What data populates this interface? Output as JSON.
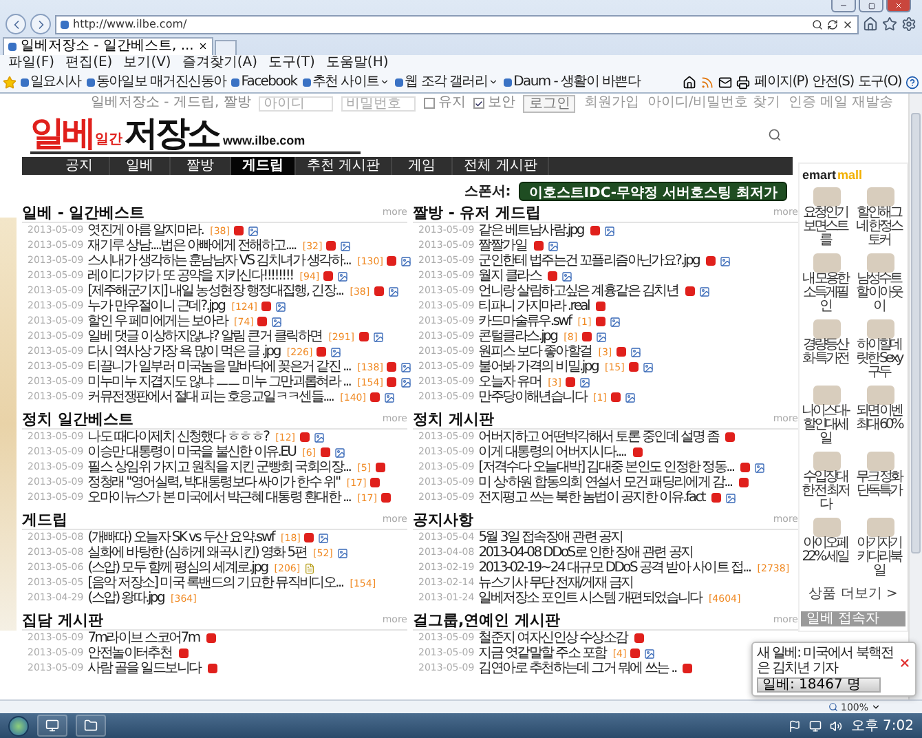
{
  "browser": {
    "url": "http://www.ilbe.com/",
    "tab_title": "일베저장소 - 일간베스트, ...",
    "menu": [
      "파일(F)",
      "편집(E)",
      "보기(V)",
      "즐겨찾기(A)",
      "도구(T)",
      "도움말(H)"
    ],
    "favorites": [
      {
        "label": "일요시사",
        "has_caret": false
      },
      {
        "label": "동아일보 매거진신동아",
        "has_caret": false
      },
      {
        "label": "Facebook",
        "has_caret": false
      },
      {
        "label": "추천 사이트",
        "has_caret": true
      },
      {
        "label": "웹 조각 갤러리",
        "has_caret": true
      },
      {
        "label": "Daum - 생활이 바쁜다",
        "has_caret": false
      }
    ],
    "commands": [
      "페이지(P)",
      "안전(S)",
      "도구(O)"
    ]
  },
  "login": {
    "site": "일베저장소 - 게드립, 짤방",
    "id_placeholder": "아이디",
    "pw_placeholder": "비밀번호",
    "options": [
      {
        "label": "유지",
        "checked": false
      },
      {
        "label": "보안",
        "checked": true
      }
    ],
    "button": "로그인",
    "links": [
      "회원가입",
      "아이디/비밀번호 찾기",
      "인증 메일 재발송"
    ]
  },
  "logo": {
    "main_a": "일베",
    "small": "일간",
    "main_b": "저장소",
    "url": "www.ilbe.com"
  },
  "nav": [
    {
      "label": "공지",
      "selected": false
    },
    {
      "label": "일베",
      "selected": false
    },
    {
      "label": "짤방",
      "selected": false
    },
    {
      "label": "게드립",
      "selected": true
    },
    {
      "label": "추천 게시판",
      "selected": false
    },
    {
      "label": "게임",
      "selected": false
    },
    {
      "label": "전체 게시판",
      "selected": false
    }
  ],
  "sponsor": {
    "label": "스폰서:",
    "button": "이호스트IDC-무약정 서버호스팅 최저가"
  },
  "sections": [
    {
      "title": "일베 - 일간베스트",
      "more": "more",
      "items": [
        {
          "date": "2013-05-09",
          "title": "엿진게 아름 알지마라.",
          "count": "[38]",
          "hot": true,
          "photo": true
        },
        {
          "date": "2013-05-09",
          "title": "재기루 상남....법은 아빠에게 전해하고....",
          "count": "[32]",
          "hot": true,
          "photo": true
        },
        {
          "date": "2013-05-09",
          "title": "스시내가 생각하는 훈남남자 VS 김치녀가 생각하...",
          "count": "[130]",
          "hot": true,
          "photo": true
        },
        {
          "date": "2013-05-09",
          "title": "레이디가가가 또 공약을 지키신다!!!!!!!!",
          "count": "[94]",
          "hot": true,
          "photo": true
        },
        {
          "date": "2013-05-09",
          "title": "[제주해군기지] 내일 농성현장 행정대집행, 긴장...",
          "count": "[38]",
          "hot": true,
          "photo": true
        },
        {
          "date": "2013-05-09",
          "title": "누가 만우절이니 근데?.jpg",
          "count": "[124]",
          "hot": true,
          "photo": true
        },
        {
          "date": "2013-05-09",
          "title": "할인 우 페미에게는 보아라",
          "count": "[74]",
          "hot": true,
          "photo": true
        },
        {
          "date": "2013-05-09",
          "title": "일베 댓글 이상하지않냐? 알림 큰거 클릭하면",
          "count": "[291]",
          "hot": true,
          "photo": true
        },
        {
          "date": "2013-05-09",
          "title": "다시 역사상 가장 욕 많이 먹은 글 .jpg",
          "count": "[226]",
          "hot": true,
          "photo": true
        },
        {
          "date": "2013-05-09",
          "title": "티끌니가 일부러 미국놈을 말바닥에 꽂은거 같진 ...",
          "count": "[138]",
          "hot": true,
          "photo": true
        },
        {
          "date": "2013-05-09",
          "title": "미누미누 지겹지도 않냐 ㅡㅡ 미누 그만괴롭혀라 ...",
          "count": "[154]",
          "hot": true,
          "photo": true
        },
        {
          "date": "2013-05-09",
          "title": "커뮤전쟁판에서 절대 피는 호응교일ㅋㅋ센들....",
          "count": "[140]",
          "hot": true,
          "photo": true
        }
      ]
    },
    {
      "title": "짤방 - 유저 게드립",
      "more": "more",
      "items": [
        {
          "date": "2013-05-09",
          "title": "같은 베트남사람.jpg",
          "hot": true,
          "photo": true
        },
        {
          "date": "2013-05-09",
          "title": "짤짤가일",
          "hot": true,
          "photo": true
        },
        {
          "date": "2013-05-09",
          "title": "군인한테 법주는건 꼬플리즘아닌가요?.jpg",
          "hot": true,
          "photo": true
        },
        {
          "date": "2013-05-09",
          "title": "월지 클라스",
          "hot": true,
          "photo": true
        },
        {
          "date": "2013-05-09",
          "title": "언니랑 살림하고싶은 계흉같은 김치년",
          "hot": true,
          "photo": true
        },
        {
          "date": "2013-05-09",
          "title": "티파니 가지마라 .real",
          "hot": true,
          "photo": false
        },
        {
          "date": "2013-05-09",
          "title": "카드마술류우.swf",
          "count": "[1]",
          "hot": true,
          "photo": true
        },
        {
          "date": "2013-05-09",
          "title": "콘털클라스.jpg",
          "count": "[8]",
          "hot": true,
          "photo": true
        },
        {
          "date": "2013-05-09",
          "title": "원피스 보다 좋아할걸",
          "count": "[3]",
          "hot": true,
          "photo": true
        },
        {
          "date": "2013-05-09",
          "title": "불어봐 가격의 비밀.jpg",
          "count": "[15]",
          "hot": true,
          "photo": true
        },
        {
          "date": "2013-05-09",
          "title": "오늘자 유머",
          "count": "[3]",
          "hot": true,
          "photo": true
        },
        {
          "date": "2013-05-09",
          "title": "만주당이해년습니다",
          "count": "[1]",
          "hot": true,
          "photo": true
        }
      ]
    },
    {
      "title": "정치 일간베스트",
      "more": "more",
      "items": [
        {
          "date": "2013-05-09",
          "title": "나도 때다이제치 신청했다 ㅎㅎㅎ?",
          "count": "[12]",
          "hot": true,
          "photo": true
        },
        {
          "date": "2013-05-09",
          "title": "이승만 대통령이 미국을 불신한 이유.EU",
          "count": "[6]",
          "hot": true,
          "photo": true
        },
        {
          "date": "2013-05-09",
          "title": "필스 상임위 가지고 원칙을 지킨 군빵회 국회의장...",
          "count": "[5]",
          "hot": true,
          "photo": false
        },
        {
          "date": "2013-05-09",
          "title": "정청래 \"영어실력, 박대통령보다 싸이가 한수 위\"",
          "count": "[17]",
          "hot": true,
          "photo": false
        },
        {
          "date": "2013-05-09",
          "title": "오마이뉴스가 본 미국에서 박근혜 대통령 환대한 ...",
          "count": "[17]",
          "hot": true,
          "photo": false
        }
      ]
    },
    {
      "title": "정치 게시판",
      "more": "more",
      "items": [
        {
          "date": "2013-05-09",
          "title": "어버지하고 어떤박각해서 토론 중인데 설명 좀",
          "hot": true,
          "photo": false
        },
        {
          "date": "2013-05-09",
          "title": "이게 대통령의 어버지시다....",
          "hot": true,
          "photo": false
        },
        {
          "date": "2013-05-09",
          "title": "[저격수다 오늘대박] 김대중 본인도 인정한 정동...",
          "hot": true,
          "photo": true
        },
        {
          "date": "2013-05-09",
          "title": "미 상·하원 합동의회 연설서 모건 패딩리에게 감...",
          "hot": true,
          "photo": false
        },
        {
          "date": "2013-05-09",
          "title": "전지평고 쓰는 북한 놈법이 공지한 이유.fact",
          "hot": true,
          "photo": true
        }
      ]
    },
    {
      "title": "게드립",
      "more": "more",
      "items": [
        {
          "date": "2013-05-08",
          "title": "(개빠따) 오늘자 SK vs 두산 요약.swf",
          "count": "[18]",
          "hot": true,
          "photo": true
        },
        {
          "date": "2013-05-08",
          "title": "실화에 바탕한 (심하게 왜곡시킨) 영화 5편",
          "count": "[52]",
          "hot": false,
          "photo": true
        },
        {
          "date": "2013-05-06",
          "title": "(스압) 모두 함께 평심의 세계로.jpg",
          "count": "[206]",
          "hot": false,
          "photo": false,
          "attach": true
        },
        {
          "date": "2013-05-05",
          "title": "[음악 저장소] 미국 록밴드의 기묘한 뮤직비디오...",
          "count": "[154]",
          "hot": false,
          "photo": false
        },
        {
          "date": "2013-04-29",
          "title": "(스압) 왕따.jpg",
          "count": "[364]",
          "hot": false,
          "photo": false
        }
      ]
    },
    {
      "title": "공지사항",
      "more": "more",
      "items": [
        {
          "date": "2013-05-04",
          "title": "5월 3일 접속장애 관련 공지",
          "hot": false,
          "photo": false
        },
        {
          "date": "2013-04-08",
          "title": "2013-04-08 DDoS로 인한 장애 관련 공지",
          "hot": false,
          "photo": false
        },
        {
          "date": "2013-02-19",
          "title": "2013-02-19~24 대규모 DDoS 공격 받아 사이트 접...",
          "count": "[2738]",
          "hot": false,
          "photo": false
        },
        {
          "date": "2013-02-14",
          "title": "뉴스기사 무단 전재/게재 금지",
          "hot": false,
          "photo": false
        },
        {
          "date": "2013-01-24",
          "title": "일베저장소 포인트 시스템 개편되었습니다",
          "count": "[4604]",
          "hot": false,
          "photo": false
        }
      ]
    },
    {
      "title": "집담 게시판",
      "more": "more",
      "items": [
        {
          "date": "2013-05-09",
          "title": "7m라이브 스코어7m",
          "hot": true,
          "photo": false
        },
        {
          "date": "2013-05-09",
          "title": "안전놀이터추천",
          "hot": true,
          "photo": false
        },
        {
          "date": "2013-05-09",
          "title": "사람 골을 일드보니다",
          "hot": true,
          "photo": false
        }
      ]
    },
    {
      "title": "걸그룹,연예인 게시판",
      "more": "more",
      "items": [
        {
          "date": "2013-05-09",
          "title": "철준지 여자신인상 수상소감",
          "hot": true,
          "photo": false
        },
        {
          "date": "2013-05-09",
          "title": "지금 엿같말할 주소 포함",
          "count": "[4]",
          "hot": true,
          "photo": true
        },
        {
          "date": "2013-05-09",
          "title": "김연아로 추천하는데 그거 뭐에 쓰는 ..",
          "hot": true,
          "photo": false
        }
      ]
    }
  ],
  "shop": {
    "logo_a": "emart",
    "logo_b": "mall",
    "products": [
      "요청인기 보면스트를",
      "할인해그네 한정스토커",
      "내 모용한 소득게필인",
      "남성수트할 이아웃이",
      "경량등산화 특가전",
      "하이힐데릿한 Sexy구두",
      "나이스대- 할인대세일",
      "되면 이벤 최대 60%",
      "수입장대한 전 최저다",
      "무크 정화 단독특가",
      "아이오페 22% 세일",
      "아기자기 키다리북일"
    ],
    "more": "상품 더보기 >",
    "visitors": "일베 접속자"
  },
  "popup": {
    "message": "새 일베: 미국에서 북핵전은 김치년 기자",
    "counter": "일베: 18467 명"
  },
  "status": {
    "zoom": "100%"
  },
  "taskbar": {
    "time": "오후 7:02"
  }
}
